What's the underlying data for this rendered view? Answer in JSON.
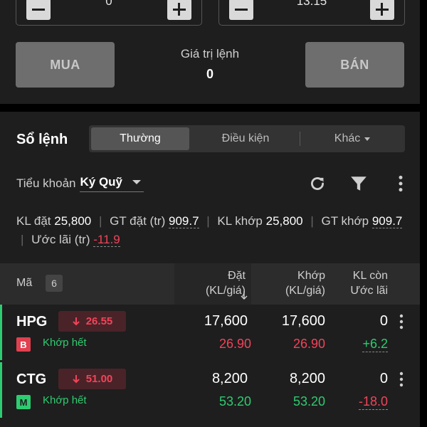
{
  "order_form": {
    "quantity": "0",
    "price": "13.15",
    "buy_label": "MUA",
    "sell_label": "BÁN",
    "order_value_label": "Giá trị lệnh",
    "order_value": "0"
  },
  "order_book": {
    "title": "Sổ lệnh",
    "tabs": [
      {
        "label": "Thường",
        "active": true
      },
      {
        "label": "Điều kiện",
        "active": false
      },
      {
        "label": "Khác",
        "active": false
      }
    ],
    "subaccount_label": "Tiểu khoản",
    "subaccount_value": "Ký Quỹ",
    "icons": [
      "refresh-icon",
      "filter-icon",
      "more-vertical-icon"
    ],
    "summary": {
      "kl_dat_label": "KL đặt",
      "kl_dat": "25,800",
      "gt_dat_label": "GT đặt (tr)",
      "gt_dat": "909.7",
      "kl_khop_label": "KL khớp",
      "kl_khop": "25,800",
      "gt_khop_label": "GT khớp",
      "gt_khop": "909.7",
      "uoc_lai_label": "Ước lãi (tr)",
      "uoc_lai": "-11.9"
    },
    "table": {
      "col_symbol": "Mã",
      "count": "6",
      "col_ordered_1": "Đặt",
      "col_ordered_2": "(KL/giá)",
      "col_matched_1": "Khớp",
      "col_matched_2": "(KL/giá)",
      "col_remaining_1": "KL còn",
      "col_remaining_2": "Ước lãi",
      "rows": [
        {
          "symbol": "HPG",
          "change": "26.55",
          "side": "B",
          "status": "Khớp hết",
          "ordered_qty": "17,600",
          "ordered_price": "26.90",
          "matched_qty": "17,600",
          "matched_price": "26.90",
          "remaining": "0",
          "pnl": "+6.2"
        },
        {
          "symbol": "CTG",
          "change": "51.00",
          "side": "M",
          "status": "Khớp hết",
          "ordered_qty": "8,200",
          "ordered_price": "53.20",
          "matched_qty": "8,200",
          "matched_price": "53.20",
          "remaining": "0",
          "pnl": "-18.0"
        }
      ]
    }
  },
  "colors": {
    "background": "#1e1e1e",
    "up": "#2ecc71",
    "down": "#f0445a",
    "button": "#6e6e6e"
  }
}
